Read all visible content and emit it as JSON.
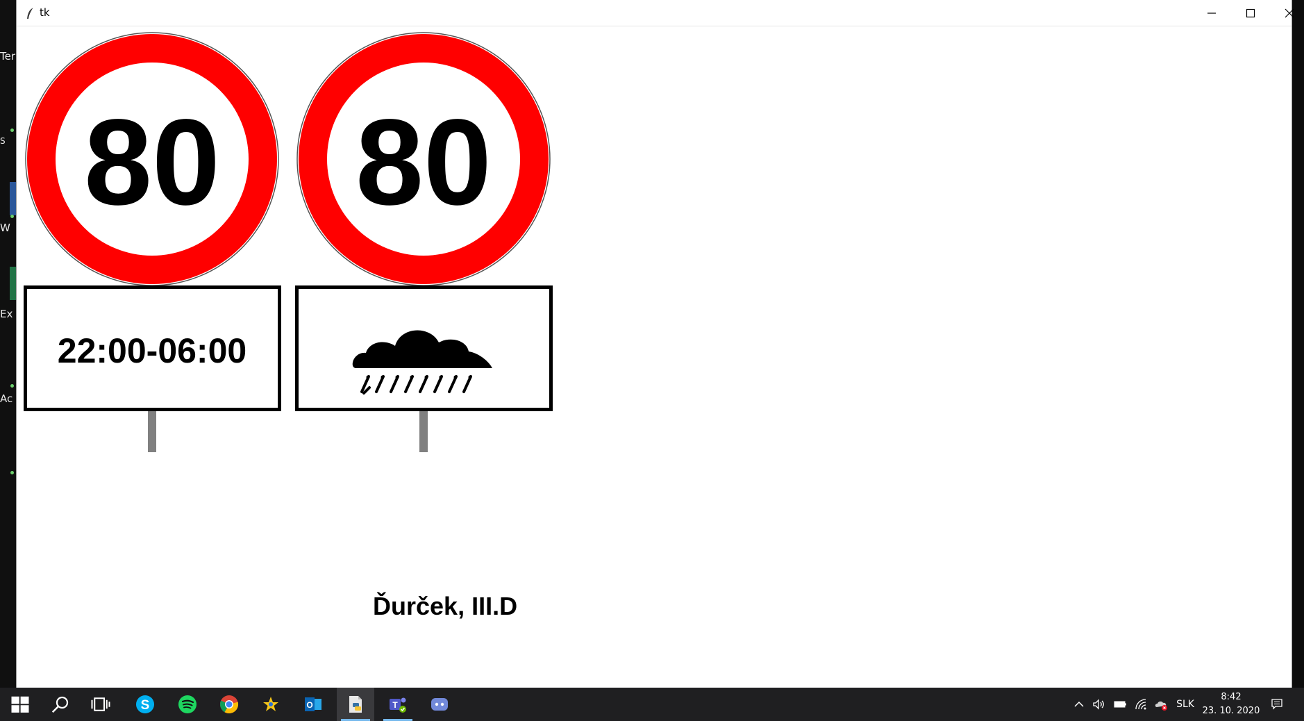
{
  "window": {
    "title": "tk",
    "icon": "tk-feather-icon",
    "controls": [
      "minimize-icon",
      "maximize-icon",
      "close-icon"
    ]
  },
  "desktop": {
    "partial_labels": [
      "Ter",
      "S",
      "W",
      "Ex",
      "Ac"
    ]
  },
  "signs": [
    {
      "speed_limit": "80",
      "supplementary_text": "22:00-06:00",
      "supplementary_icon": null
    },
    {
      "speed_limit": "80",
      "supplementary_text": "",
      "supplementary_icon": "rain-cloud-icon"
    }
  ],
  "author": "Ďurček, III.D",
  "colors": {
    "sign_ring": "#ff0000",
    "sign_fill": "#ffffff",
    "sign_text": "#000000",
    "pole": "#808080",
    "taskbar": "#1f1f21"
  },
  "taskbar": {
    "apps": [
      "windows-start-icon",
      "search-icon",
      "task-view-icon",
      "skype-icon",
      "spotify-icon",
      "chrome-icon",
      "pinned-star-icon",
      "outlook-icon",
      "python-idle-icon",
      "teams-icon",
      "discord-icon"
    ],
    "tray": {
      "language": "SLK",
      "time": "8:42",
      "date": "23. 10. 2020",
      "icons": [
        "chevron-up-icon",
        "volume-icon",
        "battery-icon",
        "wifi-icon",
        "onedrive-error-icon",
        "notification-icon"
      ]
    }
  }
}
